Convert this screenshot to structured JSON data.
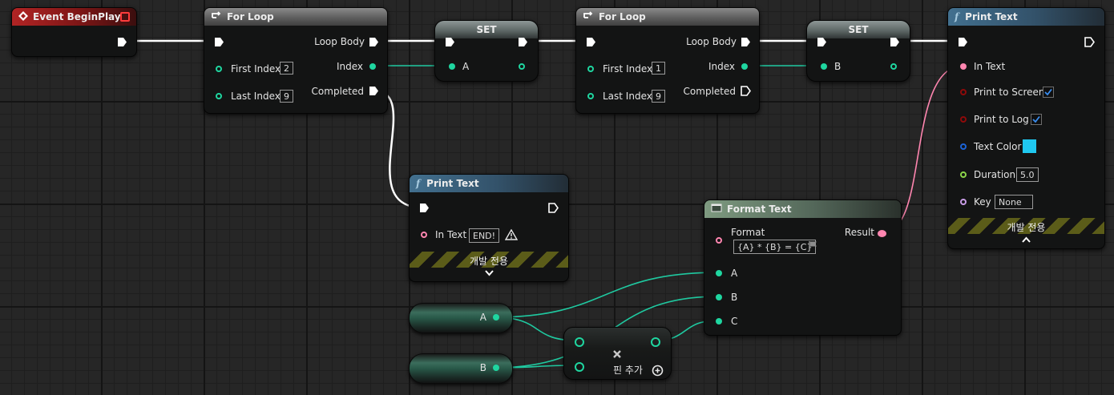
{
  "event_node": {
    "title": "Event BeginPlay"
  },
  "for_loop_1": {
    "title": "For Loop",
    "loop_body": "Loop Body",
    "first_index_label": "First Index",
    "first_index_value": "2",
    "index_label": "Index",
    "last_index_label": "Last Index",
    "last_index_value": "9",
    "completed_label": "Completed"
  },
  "set_a": {
    "title": "SET",
    "pin_label": "A"
  },
  "for_loop_2": {
    "title": "For Loop",
    "loop_body": "Loop Body",
    "first_index_label": "First Index",
    "first_index_value": "1",
    "index_label": "Index",
    "last_index_label": "Last Index",
    "last_index_value": "9",
    "completed_label": "Completed"
  },
  "set_b": {
    "title": "SET",
    "pin_label": "B"
  },
  "print_text_main": {
    "title": "Print Text",
    "in_text_label": "In Text",
    "print_screen_label": "Print to Screen",
    "print_log_label": "Print to Log",
    "text_color_label": "Text Color",
    "text_color": "#1fc8f0",
    "duration_label": "Duration",
    "duration_value": "5.0",
    "key_label": "Key",
    "key_value": "None",
    "dev_only_label": "개발 전용"
  },
  "print_text_end": {
    "title": "Print Text",
    "in_text_label": "In Text",
    "in_text_value": "END!",
    "dev_only_label": "개발 전용"
  },
  "format_text": {
    "title": "Format Text",
    "format_label": "Format",
    "format_value": "{A} * {B} = {C}",
    "result_label": "Result",
    "pin_a": "A",
    "pin_b": "B",
    "pin_c": "C"
  },
  "get_a": {
    "label": "A"
  },
  "get_b": {
    "label": "B"
  },
  "multiply_node": {
    "add_pin_label": "핀 추가"
  },
  "colors": {
    "exec": "#ffffff",
    "int": "#1fd6a0",
    "text": "#ff86b0",
    "bool": "#8e0a0a",
    "struct": "#1c63d6",
    "float": "#8cd54a",
    "name": "#c99de6"
  }
}
